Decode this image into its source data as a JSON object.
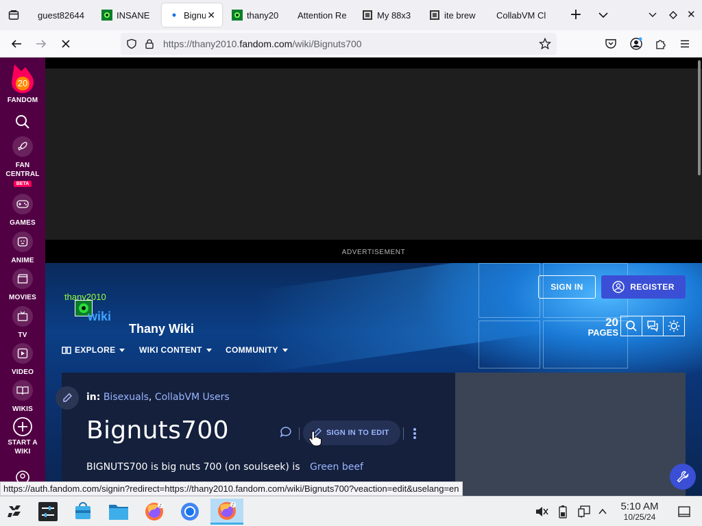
{
  "browser": {
    "tabs": [
      {
        "title": "guest82644",
        "favicon": "none",
        "active": false
      },
      {
        "title": "INSANE C",
        "favicon": "green-square-icon",
        "active": false
      },
      {
        "title": "Bignut",
        "favicon": "fandom-dot-icon",
        "active": true
      },
      {
        "title": "thany20",
        "favicon": "green-square-icon",
        "active": false
      },
      {
        "title": "Attention Re",
        "favicon": "none",
        "active": false
      },
      {
        "title": "My 88x3",
        "favicon": "pixel-icon",
        "active": false
      },
      {
        "title": "ite brew",
        "favicon": "pixel-icon",
        "active": false
      },
      {
        "title": "CollabVM Cl",
        "favicon": "none",
        "active": false
      }
    ],
    "url": {
      "prefix": "https://thany2010.",
      "domain": "fandom.com",
      "path": "/wiki/Bignuts700"
    },
    "status_link": "https://auth.fandom.com/signin?redirect=https://thany2010.fandom.com/wiki/Bignuts700?veaction=edit&uselang=en"
  },
  "sidebar": {
    "logo_text": "FANDOM",
    "logo_number": "20",
    "items": [
      {
        "label": "FAN\nCENTRAL",
        "badge": "BETA",
        "icon": "rocket-icon"
      },
      {
        "label": "GAMES",
        "icon": "gamepad-icon"
      },
      {
        "label": "ANIME",
        "icon": "anime-face-icon"
      },
      {
        "label": "MOVIES",
        "icon": "clapper-icon"
      },
      {
        "label": "TV",
        "icon": "tv-icon"
      },
      {
        "label": "VIDEO",
        "icon": "play-icon"
      },
      {
        "label": "WIKIS",
        "icon": "book-icon"
      },
      {
        "label": "START A\nWIKI",
        "icon": "plus-circle-icon"
      }
    ]
  },
  "ad": {
    "label": "ADVERTISEMENT"
  },
  "wiki": {
    "logo_text_top": "thany2010",
    "logo_text_bottom": "wiki",
    "name": "Thany Wiki",
    "sign_in": "SIGN IN",
    "register": "REGISTER",
    "pages_count": "20",
    "pages_label": "PAGES",
    "menus": [
      "EXPLORE",
      "WIKI CONTENT",
      "COMMUNITY"
    ]
  },
  "article": {
    "in_label": "in:",
    "categories": [
      "Bisexuals",
      "CollabVM Users"
    ],
    "title": "Bignuts700",
    "edit_label": "SIGN IN TO EDIT",
    "body_text": "BIGNUTS700 is big nuts 700 (on soulseek) is",
    "side_link": "Green beef"
  },
  "taskbar": {
    "time": "5:10 AM",
    "date": "10/25/24"
  },
  "colors": {
    "fandom_sidebar": "#520044",
    "register_button": "#3a4fd6",
    "link": "#9bb5ff",
    "fandom_accent": "#fa005a"
  }
}
